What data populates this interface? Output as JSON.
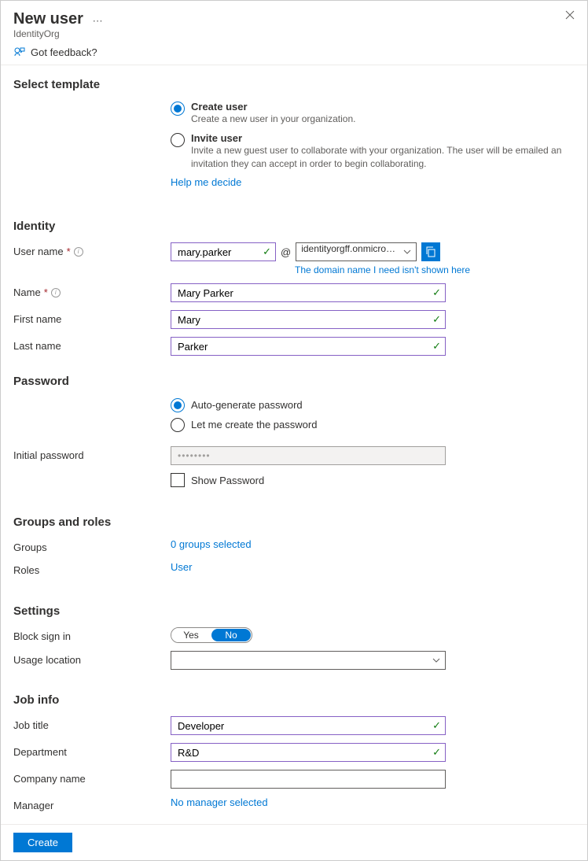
{
  "header": {
    "title": "New user",
    "subtitle": "IdentityOrg",
    "feedback": "Got feedback?"
  },
  "template": {
    "section": "Select template",
    "create_label": "Create user",
    "create_desc": "Create a new user in your organization.",
    "invite_label": "Invite user",
    "invite_desc": "Invite a new guest user to collaborate with your organization. The user will be emailed an invitation they can accept in order to begin collaborating.",
    "help_link": "Help me decide"
  },
  "identity": {
    "section": "Identity",
    "username_label": "User name",
    "username_value": "mary.parker",
    "at": "@",
    "domain_value": "identityorgff.onmicrosoft....",
    "domain_hint": "The domain name I need isn't shown here",
    "name_label": "Name",
    "name_value": "Mary Parker",
    "firstname_label": "First name",
    "firstname_value": "Mary",
    "lastname_label": "Last name",
    "lastname_value": "Parker"
  },
  "password": {
    "section": "Password",
    "auto_label": "Auto-generate password",
    "manual_label": "Let me create the password",
    "initial_label": "Initial password",
    "initial_value": "••••••••",
    "show_label": "Show Password"
  },
  "groups": {
    "section": "Groups and roles",
    "groups_label": "Groups",
    "groups_value": "0 groups selected",
    "roles_label": "Roles",
    "roles_value": "User"
  },
  "settings": {
    "section": "Settings",
    "block_label": "Block sign in",
    "yes": "Yes",
    "no": "No",
    "usage_label": "Usage location"
  },
  "job": {
    "section": "Job info",
    "title_label": "Job title",
    "title_value": "Developer",
    "dept_label": "Department",
    "dept_value": "R&D",
    "company_label": "Company name",
    "manager_label": "Manager",
    "manager_value": "No manager selected"
  },
  "footer": {
    "create": "Create"
  }
}
